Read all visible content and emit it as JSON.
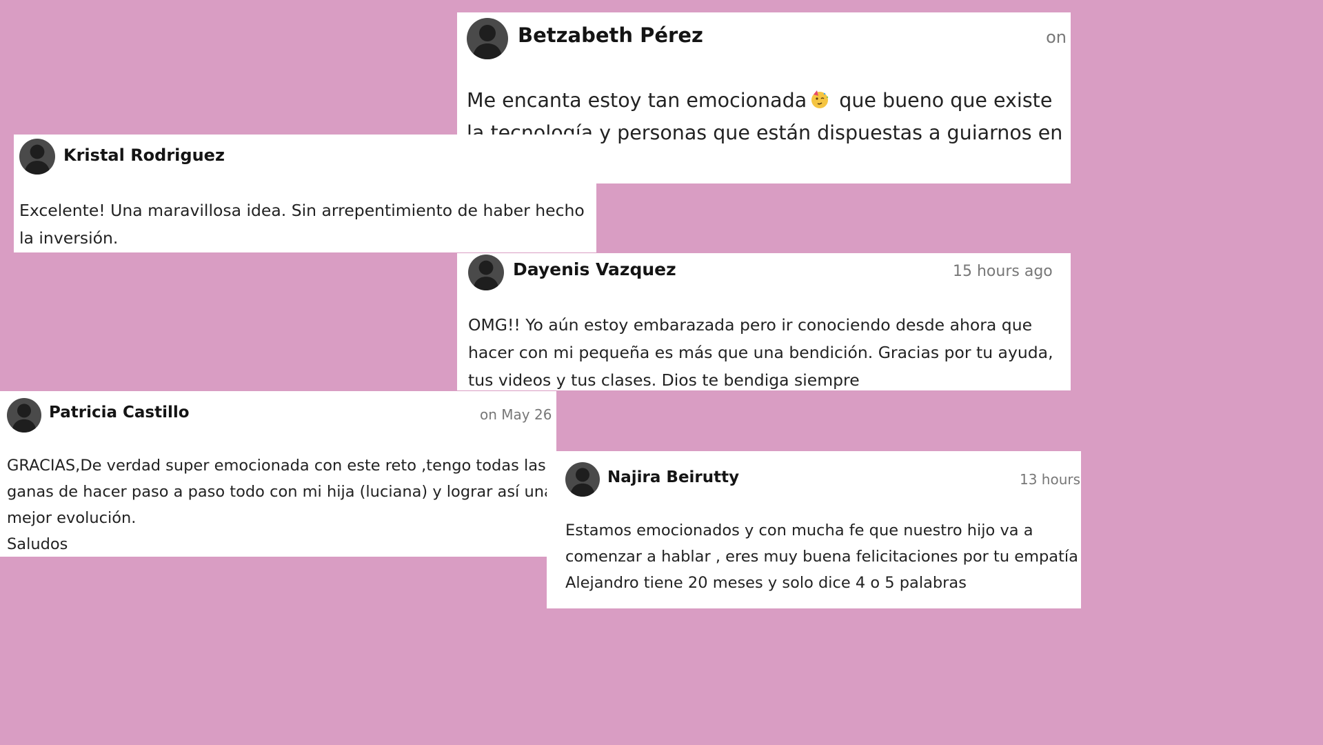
{
  "comments": [
    {
      "author": "Betzabeth Pérez",
      "time": "on",
      "text_part1": "Me encanta estoy tan emocionada",
      "emoji_icon": "partying-face-icon",
      "text_part2": " que bueno que existe la tecnología y personas que están dispuestas a guiarnos en esta etapa!!!"
    },
    {
      "author": "Kristal Rodriguez",
      "time": "",
      "text": "Excelente! Una maravillosa idea. Sin arrepentimiento de haber hecho la inversión."
    },
    {
      "author": "Dayenis Vazquez",
      "time": "15 hours ago",
      "text": "OMG!! Yo aún estoy embarazada pero ir conociendo desde ahora que hacer con mi pequeña es más que una bendición. Gracias por tu ayuda, tus videos y tus clases. Dios te bendiga siempre"
    },
    {
      "author": "Patricia Castillo",
      "time": "on May 26",
      "text": "GRACIAS,De verdad super emocionada con este reto ,tengo todas las ganas de hacer paso a paso todo con mi hija (luciana) y lograr así una mejor evolución.\nSaludos"
    },
    {
      "author": "Najira Beirutty",
      "time": "13 hours",
      "text": "Estamos emocionados y con mucha fe que nuestro hijo va a comenzar a hablar , eres muy buena felicitaciones por tu empatía Alejandro tiene 20 meses y solo dice 4 o 5 palabras"
    }
  ],
  "colors": {
    "background": "#d99dc3",
    "card": "#ffffff",
    "avatar": "#4a4a4a",
    "avatar_silhouette": "#1e1e1e",
    "timestamp": "#777777"
  },
  "icons": {
    "avatar": "default-user-silhouette-icon"
  }
}
